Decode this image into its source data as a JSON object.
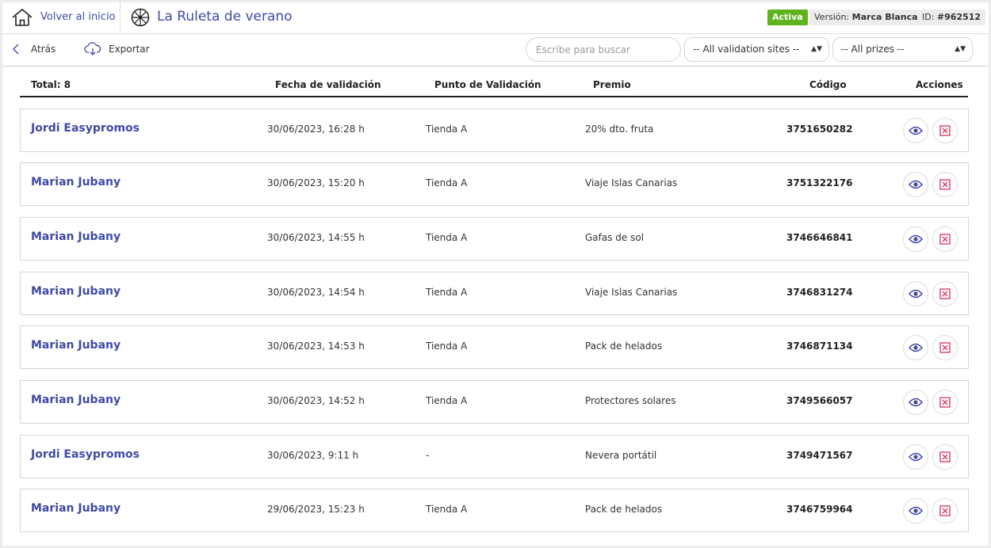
{
  "header": {
    "home_label": "Volver al inicio",
    "title": "La Ruleta de verano",
    "status_badge": "Activa",
    "version_label": "Versión:",
    "version_value": "Marca Blanca",
    "id_label": "ID:",
    "id_value": "#962512"
  },
  "toolbar": {
    "back_label": "Atrás",
    "export_label": "Exportar",
    "search_placeholder": "Escribe para buscar",
    "sites_filter": "-- All validation sites --",
    "prizes_filter": "-- All prizes --"
  },
  "table": {
    "total_label": "Total: 8",
    "columns": [
      "Fecha de validación",
      "Punto de Validación",
      "Premio",
      "Código",
      "Acciones"
    ],
    "rows": [
      {
        "name": "Jordi Easypromos",
        "date": "30/06/2023, 16:28 h",
        "site": "Tienda A",
        "prize": "20% dto. fruta",
        "code": "3751650282"
      },
      {
        "name": "Marian Jubany",
        "date": "30/06/2023, 15:20 h",
        "site": "Tienda A",
        "prize": "Viaje Islas Canarias",
        "code": "3751322176"
      },
      {
        "name": "Marian Jubany",
        "date": "30/06/2023, 14:55 h",
        "site": "Tienda A",
        "prize": "Gafas de sol",
        "code": "3746646841"
      },
      {
        "name": "Marian Jubany",
        "date": "30/06/2023, 14:54 h",
        "site": "Tienda A",
        "prize": "Viaje Islas Canarias",
        "code": "3746831274"
      },
      {
        "name": "Marian Jubany",
        "date": "30/06/2023, 14:53 h",
        "site": "Tienda A",
        "prize": "Pack de helados",
        "code": "3746871134"
      },
      {
        "name": "Marian Jubany",
        "date": "30/06/2023, 14:52 h",
        "site": "Tienda A",
        "prize": "Protectores solares",
        "code": "3749566057"
      },
      {
        "name": "Jordi Easypromos",
        "date": "30/06/2023, 9:11 h",
        "site": "-",
        "prize": "Nevera portátil",
        "code": "3749471567"
      },
      {
        "name": "Marian Jubany",
        "date": "29/06/2023, 15:23 h",
        "site": "Tienda A",
        "prize": "Pack de helados",
        "code": "3746759964"
      }
    ]
  },
  "icons": {
    "home": "home-icon",
    "wheel": "roulette-wheel-icon",
    "back": "chevron-left-icon",
    "export": "cloud-download-icon",
    "view": "eye-icon",
    "delete": "close-box-icon"
  },
  "colors": {
    "accent": "#3f4aa6",
    "active": "#5fb31f",
    "delete": "#d6335a"
  }
}
